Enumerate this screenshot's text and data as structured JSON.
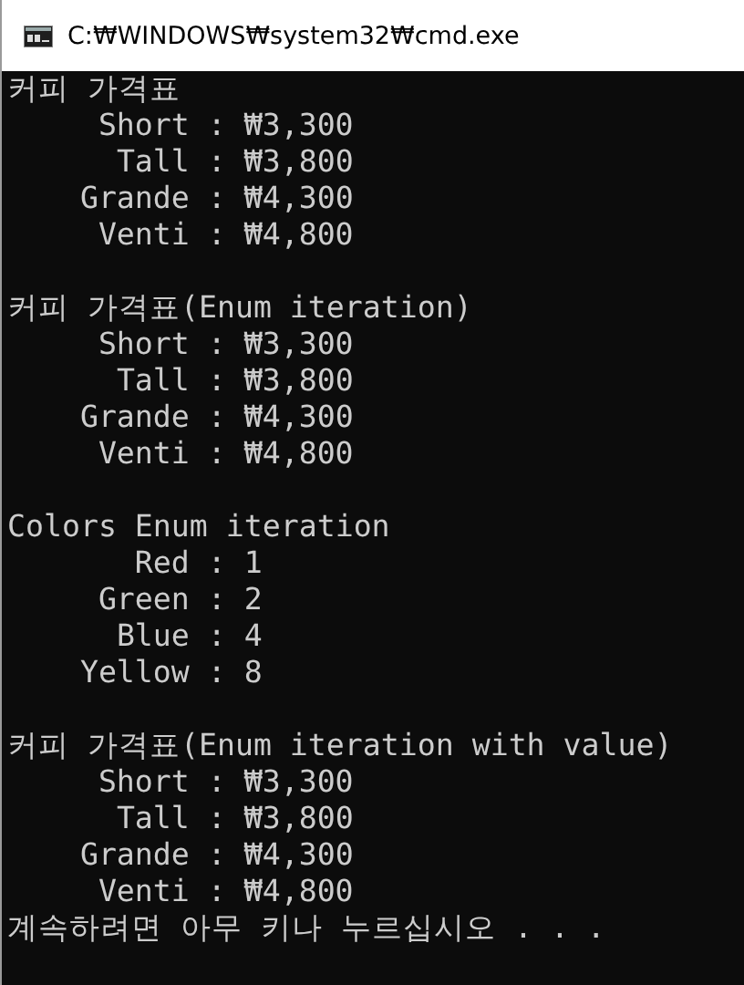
{
  "window": {
    "title": "C:₩WINDOWS₩system32₩cmd.exe"
  },
  "console": {
    "separator": ":",
    "sections": [
      {
        "title": "커피 가격표",
        "rows": [
          {
            "name": "Short",
            "value": "₩3,300"
          },
          {
            "name": "Tall",
            "value": "₩3,800"
          },
          {
            "name": "Grande",
            "value": "₩4,300"
          },
          {
            "name": "Venti",
            "value": "₩4,800"
          }
        ]
      },
      {
        "title": "커피 가격표(Enum iteration)",
        "rows": [
          {
            "name": "Short",
            "value": "₩3,300"
          },
          {
            "name": "Tall",
            "value": "₩3,800"
          },
          {
            "name": "Grande",
            "value": "₩4,300"
          },
          {
            "name": "Venti",
            "value": "₩4,800"
          }
        ]
      },
      {
        "title": "Colors Enum iteration",
        "rows": [
          {
            "name": "Red",
            "value": "1"
          },
          {
            "name": "Green",
            "value": "2"
          },
          {
            "name": "Blue",
            "value": "4"
          },
          {
            "name": "Yellow",
            "value": "8"
          }
        ]
      },
      {
        "title": "커피 가격표(Enum iteration with value)",
        "rows": [
          {
            "name": "Short",
            "value": "₩3,300"
          },
          {
            "name": "Tall",
            "value": "₩3,800"
          },
          {
            "name": "Grande",
            "value": "₩4,300"
          },
          {
            "name": "Venti",
            "value": "₩4,800"
          }
        ]
      }
    ],
    "prompt": "계속하려면 아무 키나 누르십시오 . . ."
  }
}
